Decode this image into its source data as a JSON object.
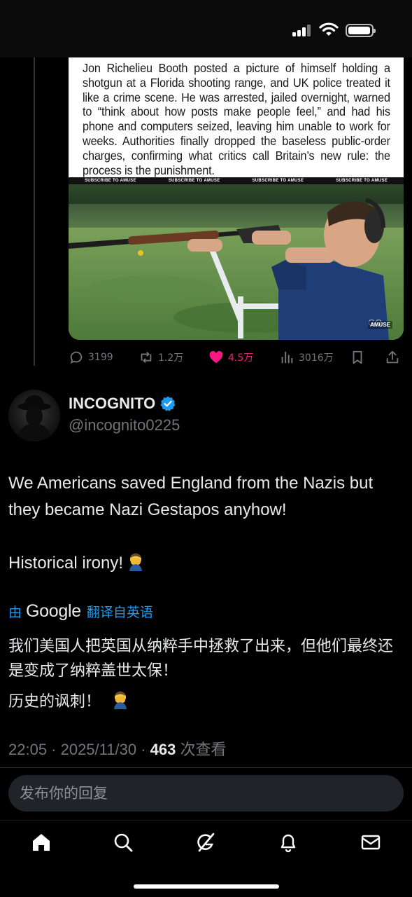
{
  "status_bar": {
    "signal": "cellular-signal-icon",
    "wifi": "wifi-icon",
    "battery": "battery-icon"
  },
  "quoted_media": {
    "caption": "Jon Richelieu Booth posted a picture of himself holding a shotgun at a Florida shooting range, and UK police treated it like a crime scene. He was arrested, jailed overnight, warned to “think about how posts make people feel,” and had his phone and computers seized, leaving him unable to work for weeks. Authorities finally dropped the baseless public-order charges, confirming what critics call Britain’s new rule: the process is the punishment.",
    "strip_labels": [
      "SUBSCRIBE TO AMUSE",
      "SUBSCRIBE TO AMUSE",
      "SUBSCRIBE TO AMUSE",
      "SUBSCRIBE TO AMUSE"
    ],
    "watermark": "AMUSE"
  },
  "actions": {
    "replies": "3199",
    "reposts": "1.2万",
    "likes": "4.5万",
    "views": "3016万"
  },
  "author": {
    "name": "INCOGNITO",
    "handle": "@incognito0225",
    "verified_color": "#1d9bf0"
  },
  "post": {
    "text": "We Americans saved England from the Nazis but they became Nazi Gestapos anyhow!\n\nHistorical irony!"
  },
  "translation": {
    "prefix": "由",
    "brand": "Google",
    "label": "翻译自英语",
    "text": "我们美国人把英国从纳粹手中拯救了出来，但他们最终还是变成了纳粹盖世太保！",
    "text2": "历史的讽刺！"
  },
  "meta": {
    "time": "22:05 · 2025/11/30 · ",
    "views_count": "463",
    "views_label": " 次查看"
  },
  "reply": {
    "placeholder": "发布你的回复"
  },
  "tabbar": [
    "home-icon",
    "search-icon",
    "grok-icon",
    "notifications-icon",
    "messages-icon"
  ],
  "colors": {
    "accent": "#1d9bf0",
    "like": "#f91880",
    "muted": "#71767b",
    "background": "#000000"
  }
}
